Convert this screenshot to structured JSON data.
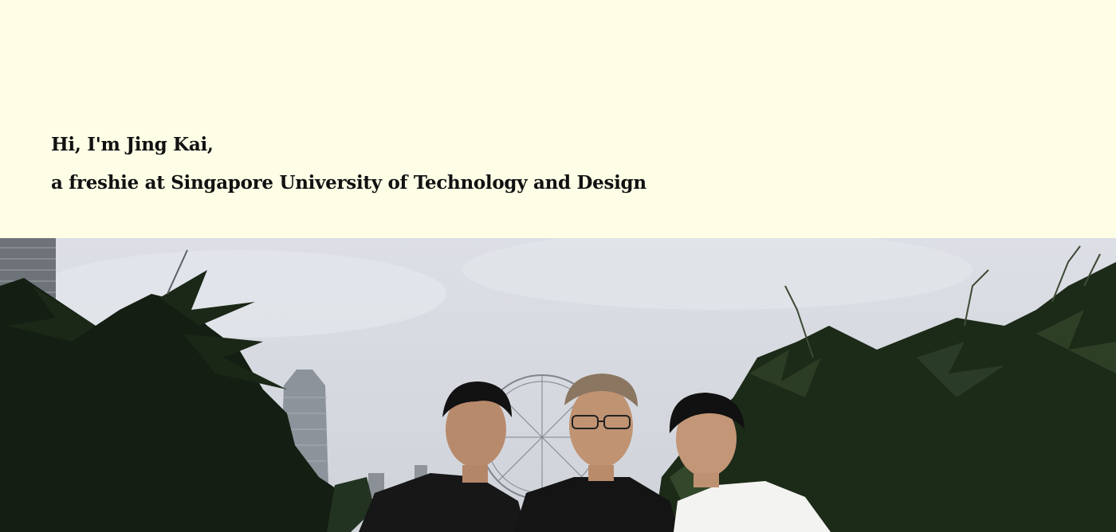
{
  "hero": {
    "greeting": "Hi, I'm Jing Kai,",
    "subtitle": "a freshie at Singapore University of Technology and Design"
  },
  "photo": {
    "subject": "group-photo",
    "colors": {
      "background": "#fefde6",
      "sky": "#d8dce2",
      "foliage": "#1c2a18",
      "text": "#111111"
    }
  }
}
